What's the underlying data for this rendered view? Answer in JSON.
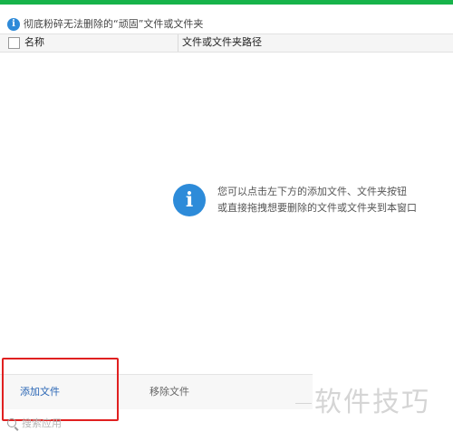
{
  "info_bar": {
    "icon": "info-icon",
    "text": "彻底粉碎无法删除的“顽固”文件或文件夹"
  },
  "table": {
    "columns": [
      "名称",
      "文件或文件夹路径"
    ]
  },
  "empty_tip": {
    "icon": "info-icon",
    "line1": "您可以点击左下方的添加文件、文件夹按钮",
    "line2": "或直接拖拽想要删除的文件或文件夹到本窗口"
  },
  "toolbar": {
    "add_label": "添加文件",
    "remove_label": "移除文件"
  },
  "search": {
    "placeholder": "搜索应用",
    "icon": "search-icon"
  },
  "watermark": {
    "text": "软件技巧"
  },
  "colors": {
    "accent_green": "#17b34a",
    "info_blue": "#2d8bd9",
    "highlight_red": "#e02020",
    "link_blue": "#2a66b5"
  }
}
